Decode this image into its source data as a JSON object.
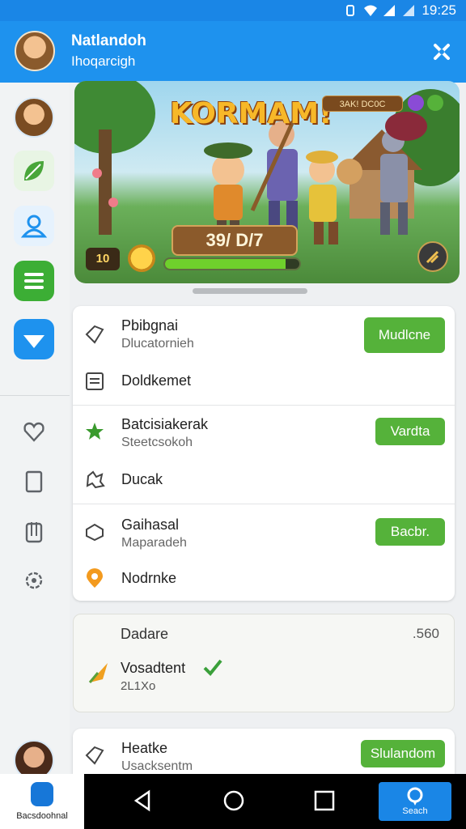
{
  "status": {
    "time": "19:25"
  },
  "header": {
    "title": "Natlandoh",
    "subtitle": "Ihoqarcigh"
  },
  "banner": {
    "game_title": "KORMAM!",
    "score_label": "3AK! DC0C",
    "counter": "39/ D/7",
    "level": "10",
    "progress_fraction": 0.9
  },
  "list1": [
    {
      "title": "Pbibgnai",
      "subtitle": "Dlucatornieh",
      "button": "Mudlcne",
      "icon": "tag-icon"
    },
    {
      "title": "Doldkemet",
      "icon": "list-icon"
    }
  ],
  "list2": [
    {
      "title": "Batcisiakerak",
      "subtitle": "Steetcsokoh",
      "button": "Vardta",
      "icon": "star-icon"
    },
    {
      "title": "Ducak",
      "icon": "puzzle-icon"
    }
  ],
  "list3": [
    {
      "title": "Gaihasal",
      "subtitle": "Maparadeh",
      "button": "Bacbr.",
      "icon": "controller-icon"
    },
    {
      "title": "Nodrnke",
      "icon": "location-pin-icon"
    }
  ],
  "leaderboard": {
    "label": "Dadare",
    "number": ".560",
    "name": "Vosadtent",
    "sub": "2L1Xo"
  },
  "last_card": {
    "title": "Heatke",
    "subtitle": "Usacksentm",
    "button": "Slulandom"
  },
  "bottom": {
    "left_label": "Bacsdoohnal",
    "search_label": "Seach"
  },
  "colors": {
    "accent": "#1e92ee",
    "button_green": "#55b23a"
  }
}
